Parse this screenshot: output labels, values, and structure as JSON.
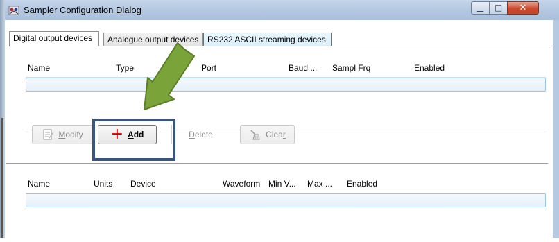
{
  "window": {
    "title": "Sampler Configuration Dialog",
    "min_glyph": "▁",
    "max_glyph": "□",
    "close_glyph": "✕"
  },
  "tabs": [
    {
      "label": "Digital output devices",
      "active": true
    },
    {
      "label": "Analogue output devices",
      "active": false
    },
    {
      "label": "RS232 ASCII streaming devices",
      "active": false
    }
  ],
  "upper_table": {
    "columns": [
      "Name",
      "Type",
      "Port",
      "Baud ...",
      "Sampl Frq",
      "Enabled"
    ]
  },
  "buttons": {
    "modify": {
      "pre": "",
      "mnemonic": "M",
      "post": "odify"
    },
    "add": {
      "pre": "",
      "mnemonic": "A",
      "post": "dd",
      "glyph": "+"
    },
    "delete": {
      "pre": "",
      "mnemonic": "D",
      "post": "elete"
    },
    "clear": {
      "pre": "Clea",
      "mnemonic": "r",
      "post": ""
    }
  },
  "lower_table": {
    "columns": [
      "Name",
      "Units",
      "Device",
      "Waveform",
      "Min V...",
      "Max ...",
      "Enabled"
    ]
  },
  "colors": {
    "highlight_box": "#3a5580",
    "arrow": "#7aa33a",
    "selection": "#9cc4e4"
  }
}
